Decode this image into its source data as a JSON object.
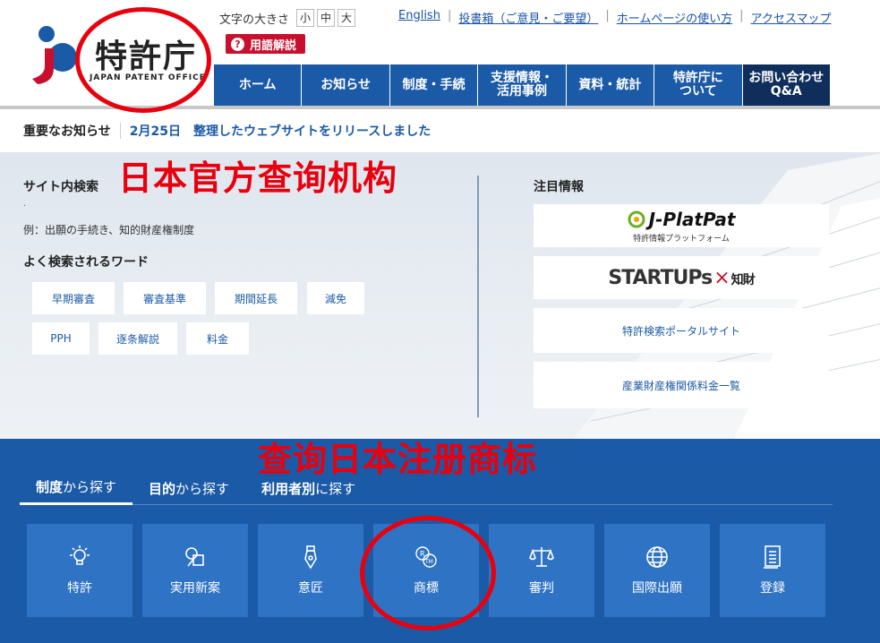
{
  "logo": {
    "text": "特許庁",
    "sub": "JAPAN PATENT OFFICE"
  },
  "font_size": {
    "label": "文字の大きさ",
    "small": "小",
    "medium": "中",
    "large": "大"
  },
  "glossary": {
    "icon": "question-icon",
    "label": "用語解説"
  },
  "top_links": [
    "English",
    "投書箱（ご意見・ご要望）",
    "ホームページの使い方",
    "アクセスマップ"
  ],
  "global_nav": [
    {
      "label": "ホーム"
    },
    {
      "label": "お知らせ"
    },
    {
      "label": "制度・手続"
    },
    {
      "label": "支援情報・\n活用事例"
    },
    {
      "label": "資料・統計"
    },
    {
      "label": "特許庁に\nついて"
    },
    {
      "label": "お問い合わせ\nQ&A"
    }
  ],
  "notice": {
    "label": "重要なお知らせ",
    "date": "2月25日",
    "text": "整理したウェブサイトをリリースしました"
  },
  "search": {
    "title": "サイト内検索",
    "placeholder": ".",
    "example": "例：出願の手続き、知的財産権制度",
    "popular_title": "よく検索されるワード",
    "keywords": [
      "早期審査",
      "審査基準",
      "期間延長",
      "減免",
      "PPH",
      "逐条解説",
      "料金"
    ]
  },
  "featured": {
    "title": "注目情報",
    "jplatpat": {
      "name": "J-PlatPat",
      "sub": "特許情報プラットフォーム"
    },
    "startups": {
      "name": "STARTUPs",
      "cross": "×",
      "tail": "知財"
    },
    "portal": "特許検索ポータルサイト",
    "fees": "産業財産権関係料金一覧"
  },
  "tabs": [
    {
      "strong": "制度",
      "rest": "から探す"
    },
    {
      "strong": "目的",
      "rest": "から探す"
    },
    {
      "strong": "利用者別",
      "rest": "に探す"
    }
  ],
  "categories": [
    {
      "label": "特許",
      "icon": "lightbulb-icon"
    },
    {
      "label": "実用新案",
      "icon": "shapes-icon"
    },
    {
      "label": "意匠",
      "icon": "pen-nib-icon"
    },
    {
      "label": "商標",
      "icon": "trademark-icon"
    },
    {
      "label": "審判",
      "icon": "scales-icon"
    },
    {
      "label": "国際出願",
      "icon": "globe-icon"
    },
    {
      "label": "登録",
      "icon": "document-icon"
    }
  ],
  "annotations": {
    "agency": "日本官方查询机构",
    "trademark": "查询日本注册商标"
  },
  "colors": {
    "brand_blue": "#1b5aa6",
    "dark_navy": "#0f2e5c",
    "accent_red": "#c8102e",
    "annotation_red": "#e8000e",
    "tile_blue": "#2f73c5"
  }
}
